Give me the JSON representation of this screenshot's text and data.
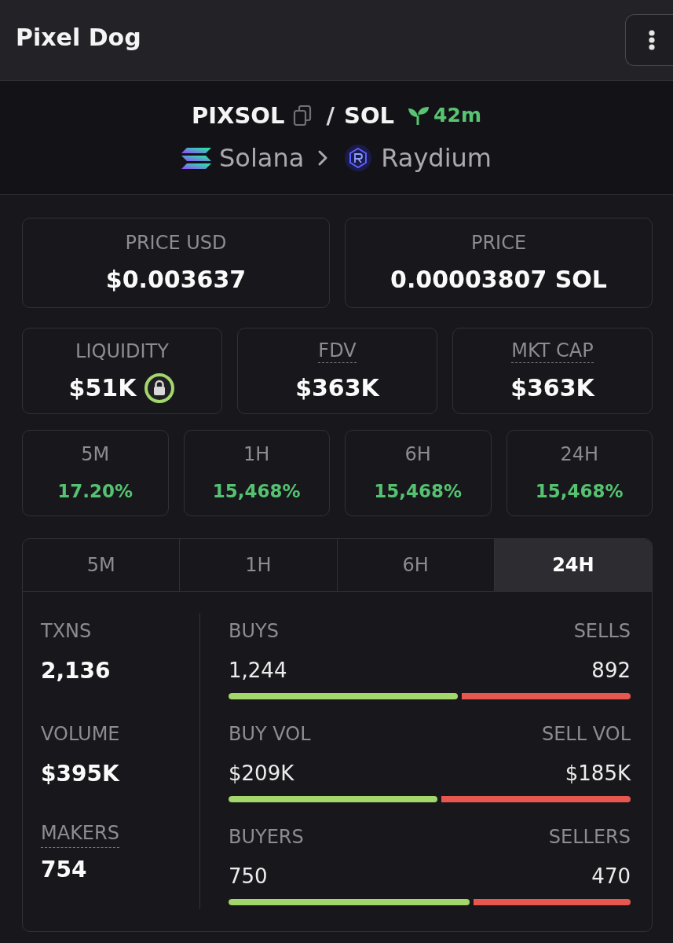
{
  "header": {
    "title": "Pixel Dog"
  },
  "pair": {
    "base": "PIXSOL",
    "separator": "/",
    "quote": "SOL",
    "age": "42m",
    "chain": "Solana",
    "dex": "Raydium"
  },
  "price_cards": [
    {
      "label": "PRICE USD",
      "value": "$0.003637"
    },
    {
      "label": "PRICE",
      "value": "0.00003807 SOL"
    }
  ],
  "stat_cards": [
    {
      "label": "LIQUIDITY",
      "value": "$51K",
      "kind": "locked"
    },
    {
      "label": "FDV",
      "value": "$363K",
      "kind": "hinted"
    },
    {
      "label": "MKT CAP",
      "value": "$363K",
      "kind": "hinted"
    }
  ],
  "changes": [
    {
      "label": "5M",
      "value": "17.20%",
      "positive": true
    },
    {
      "label": "1H",
      "value": "15,468%",
      "positive": true
    },
    {
      "label": "6H",
      "value": "15,468%",
      "positive": true
    },
    {
      "label": "24H",
      "value": "15,468%",
      "positive": true
    }
  ],
  "periods": {
    "tabs": [
      {
        "label": "5M",
        "selected": false
      },
      {
        "label": "1H",
        "selected": false
      },
      {
        "label": "6H",
        "selected": false
      },
      {
        "label": "24H",
        "selected": true
      }
    ],
    "summary": [
      {
        "label": "TXNS",
        "value": "2,136",
        "kind": "plain"
      },
      {
        "label": "VOLUME",
        "value": "$395K",
        "kind": "plain"
      },
      {
        "label": "MAKERS",
        "value": "754",
        "kind": "hinted"
      }
    ],
    "splits": [
      {
        "left_label": "BUYS",
        "left_value": "1,244",
        "right_label": "SELLS",
        "right_value": "892",
        "level": 0.58
      },
      {
        "left_label": "BUY VOL",
        "left_value": "$209K",
        "right_label": "SELL VOL",
        "right_value": "$185K",
        "level": 0.53
      },
      {
        "left_label": "BUYERS",
        "left_value": "750",
        "right_label": "SELLERS",
        "right_value": "470",
        "level": 0.61
      }
    ]
  }
}
